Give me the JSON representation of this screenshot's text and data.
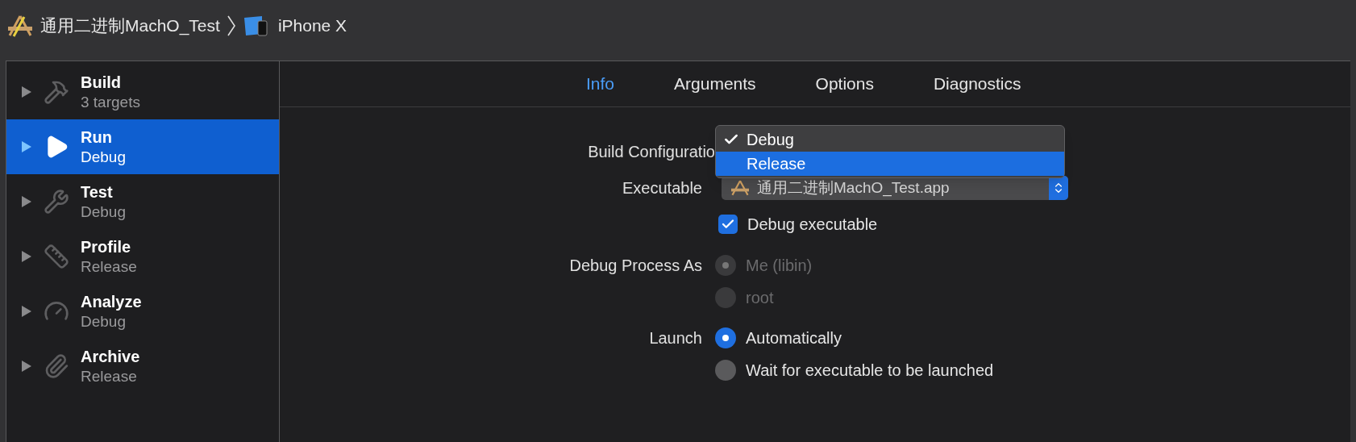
{
  "breadcrumb": {
    "project": "通用二进制MachO_Test",
    "device": "iPhone X"
  },
  "sidebar": {
    "items": [
      {
        "name": "Build",
        "subtitle": "3 targets",
        "selected": false
      },
      {
        "name": "Run",
        "subtitle": "Debug",
        "selected": true
      },
      {
        "name": "Test",
        "subtitle": "Debug",
        "selected": false
      },
      {
        "name": "Profile",
        "subtitle": "Release",
        "selected": false
      },
      {
        "name": "Analyze",
        "subtitle": "Debug",
        "selected": false
      },
      {
        "name": "Archive",
        "subtitle": "Release",
        "selected": false
      }
    ]
  },
  "tabs": [
    {
      "label": "Info",
      "selected": true
    },
    {
      "label": "Arguments",
      "selected": false
    },
    {
      "label": "Options",
      "selected": false
    },
    {
      "label": "Diagnostics",
      "selected": false
    }
  ],
  "build_configuration": {
    "label": "Build Configuratio",
    "menu": [
      {
        "label": "Debug",
        "checked": true,
        "selected": false
      },
      {
        "label": "Release",
        "checked": false,
        "selected": true
      }
    ]
  },
  "executable": {
    "label": "Executable",
    "value": "通用二进制MachO_Test.app"
  },
  "debug_executable": {
    "label": "Debug executable",
    "checked": true
  },
  "debug_process_as": {
    "label": "Debug Process As",
    "disabled": true,
    "options": [
      {
        "label": "Me (libin)",
        "selected": true
      },
      {
        "label": "root",
        "selected": false
      }
    ]
  },
  "launch": {
    "label": "Launch",
    "disabled": false,
    "options": [
      {
        "label": "Automatically",
        "selected": true
      },
      {
        "label": "Wait for executable to be launched",
        "selected": false
      }
    ]
  }
}
